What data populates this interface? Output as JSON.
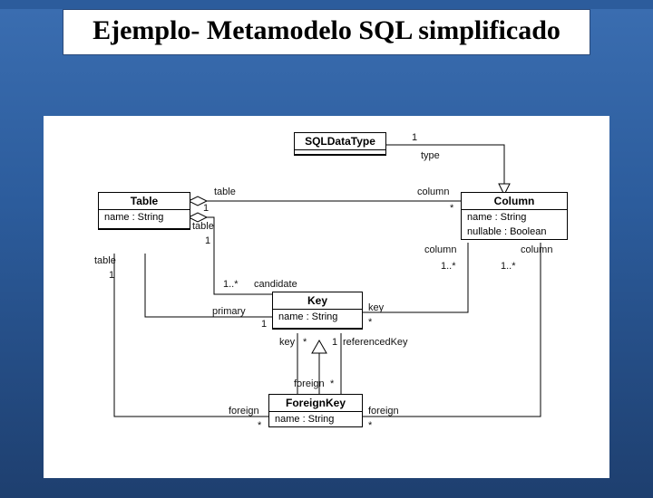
{
  "title": "Ejemplo- Metamodelo SQL simplificado",
  "cls": {
    "sqldatatype": "SQLDataType",
    "table": "Table",
    "column": "Column",
    "key": "Key",
    "foreignkey": "ForeignKey"
  },
  "attr": {
    "table_name": "name : String",
    "column_name": "name : String",
    "column_nullable": "nullable : Boolean",
    "key_name": "name : String",
    "fk_name": "name : String"
  },
  "role": {
    "type": "type",
    "table": "table",
    "column": "column",
    "candidate": "candidate",
    "primary": "primary",
    "key": "key",
    "referencedKey": "referencedKey",
    "foreign": "foreign"
  },
  "mult": {
    "one": "1",
    "star": "*",
    "one_star": "1..*"
  }
}
